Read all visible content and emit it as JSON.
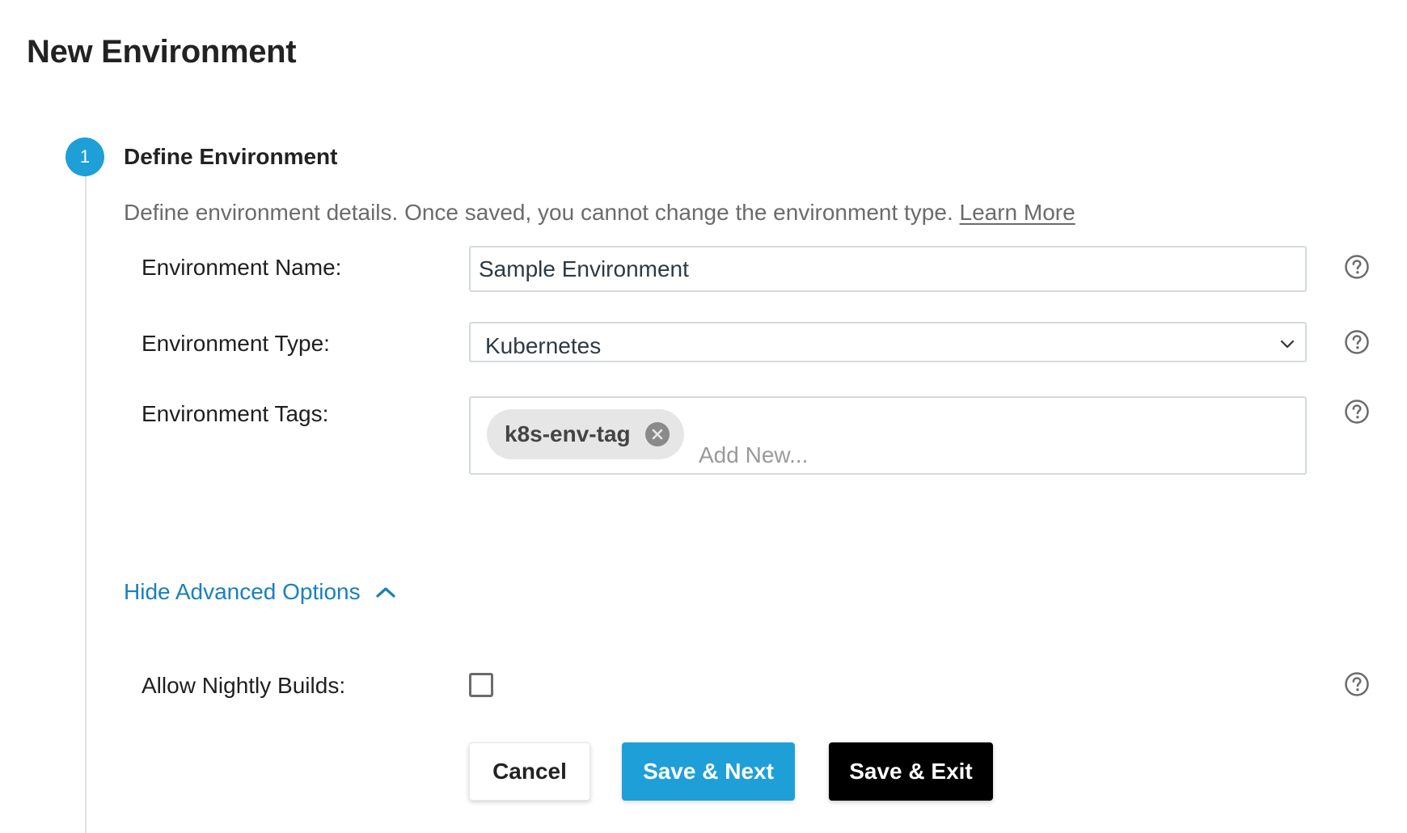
{
  "page": {
    "title": "New Environment"
  },
  "step": {
    "number": "1",
    "title": "Define Environment",
    "description": "Define environment details. Once saved, you cannot change the environment type.",
    "learn_more": "Learn More"
  },
  "fields": {
    "name": {
      "label": "Environment Name:",
      "value": "Sample Environment"
    },
    "type": {
      "label": "Environment Type:",
      "value": "Kubernetes"
    },
    "tags": {
      "label": "Environment Tags:",
      "items": [
        "k8s-env-tag"
      ],
      "placeholder": "Add New..."
    },
    "nightly": {
      "label": "Allow Nightly Builds:",
      "checked": false
    }
  },
  "advanced": {
    "toggle_label": "Hide Advanced Options"
  },
  "buttons": {
    "cancel": "Cancel",
    "save_next": "Save & Next",
    "save_exit": "Save & Exit"
  },
  "colors": {
    "accent": "#1f9fd8",
    "link": "#1a7fc0",
    "primary_dark": "#000000"
  },
  "icons": {
    "help": "question-circle-icon",
    "dropdown": "chevron-down-icon",
    "toggle": "chevron-up-icon",
    "tag_remove": "close-circle-icon"
  }
}
